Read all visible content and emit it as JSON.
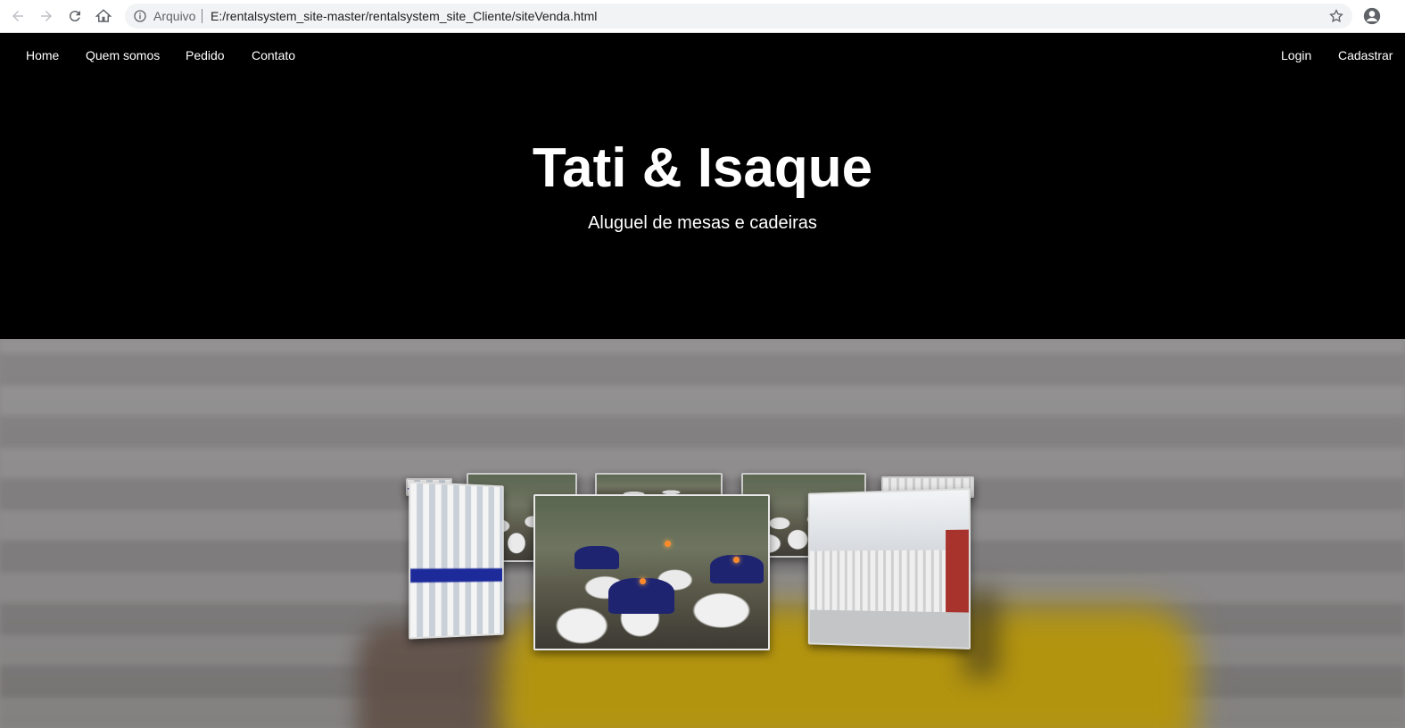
{
  "browser": {
    "scheme_label": "Arquivo",
    "url": "E:/rentalsystem_site-master/rentalsystem_site_Cliente/siteVenda.html",
    "icons": [
      "back-arrow-icon",
      "forward-arrow-icon",
      "reload-icon",
      "home-icon",
      "info-icon",
      "star-icon",
      "profile-icon"
    ]
  },
  "nav": {
    "left": [
      "Home",
      "Quem somos",
      "Pedido",
      "Contato"
    ],
    "right": [
      "Login",
      "Cadastrar"
    ]
  },
  "hero": {
    "title": "Tati & Isaque",
    "subtitle": "Aluguel de mesas e cadeiras"
  },
  "colors": {
    "header_bg": "#000000",
    "nav_text": "#ffffff",
    "section_bg": "#8a8888",
    "accent_yellow": "#b3940f"
  }
}
